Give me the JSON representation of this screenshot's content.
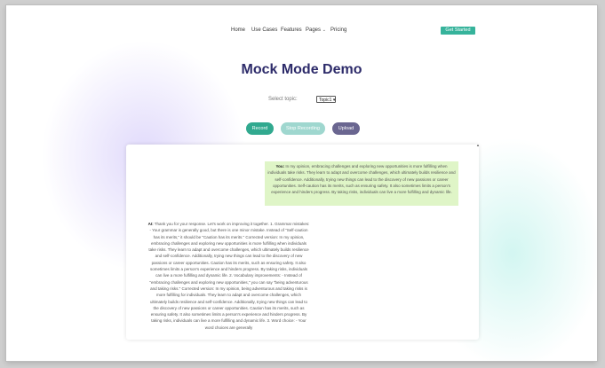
{
  "nav": {
    "items": [
      "Home",
      "Use Cases",
      "Features",
      "Pages",
      "Pricing"
    ],
    "pages_caret": "⌄",
    "cta": "Get Started"
  },
  "title": "Mock Mode Demo",
  "topic": {
    "label": "Select topic:",
    "selected": "Topic1 ▾"
  },
  "buttons": {
    "record": "Record",
    "stop": "Stop Recording",
    "upload": "Upload"
  },
  "chat": {
    "scroll_arrow": "▲",
    "user": {
      "speaker": "You:",
      "text": "In my opinion, embracing challenges and exploring new opportunities is more fulfilling when individuals take risks. They learn to adapt and overcome challenges, which ultimately builds resilience and self-confidence. Additionally, trying new things can lead to the discovery of new passions or career opportunities. Self-caution has its merits, such as ensuring safety. It also sometimes limits a person's experience and hinders progress. By taking risks, individuals can live a more fulfilling and dynamic life."
    },
    "ai": {
      "speaker": "AI:",
      "text": "Thank you for your response. Let's work on improving it together. 1. Grammar mistakes: - Your grammar is generally good, but there is one minor mistake. Instead of \"Self-caution has its merits,\" it should be \"Caution has its merits.\" Corrected version: In my opinion, embracing challenges and exploring new opportunities is more fulfilling when individuals take risks. They learn to adapt and overcome challenges, which ultimately builds resilience and self-confidence. Additionally, trying new things can lead to the discovery of new passions or career opportunities. Caution has its merits, such as ensuring safety. It also sometimes limits a person's experience and hinders progress. By taking risks, individuals can live a more fulfilling and dynamic life. 2. Vocabulary improvements: - Instead of \"embracing challenges and exploring new opportunities,\" you can say \"being adventurous and taking risks.\" Corrected version: In my opinion, being adventurous and taking risks is more fulfilling for individuals. They learn to adapt and overcome challenges, which ultimately builds resilience and self-confidence. Additionally, trying new things can lead to the discovery of new passions or career opportunities. Caution has its merits, such as ensuring safety. It also sometimes limits a person's experience and hinders progress. By taking risks, individuals can live a more fulfilling and dynamic life. 3. Word choice: - Your word choices are generally"
    }
  }
}
